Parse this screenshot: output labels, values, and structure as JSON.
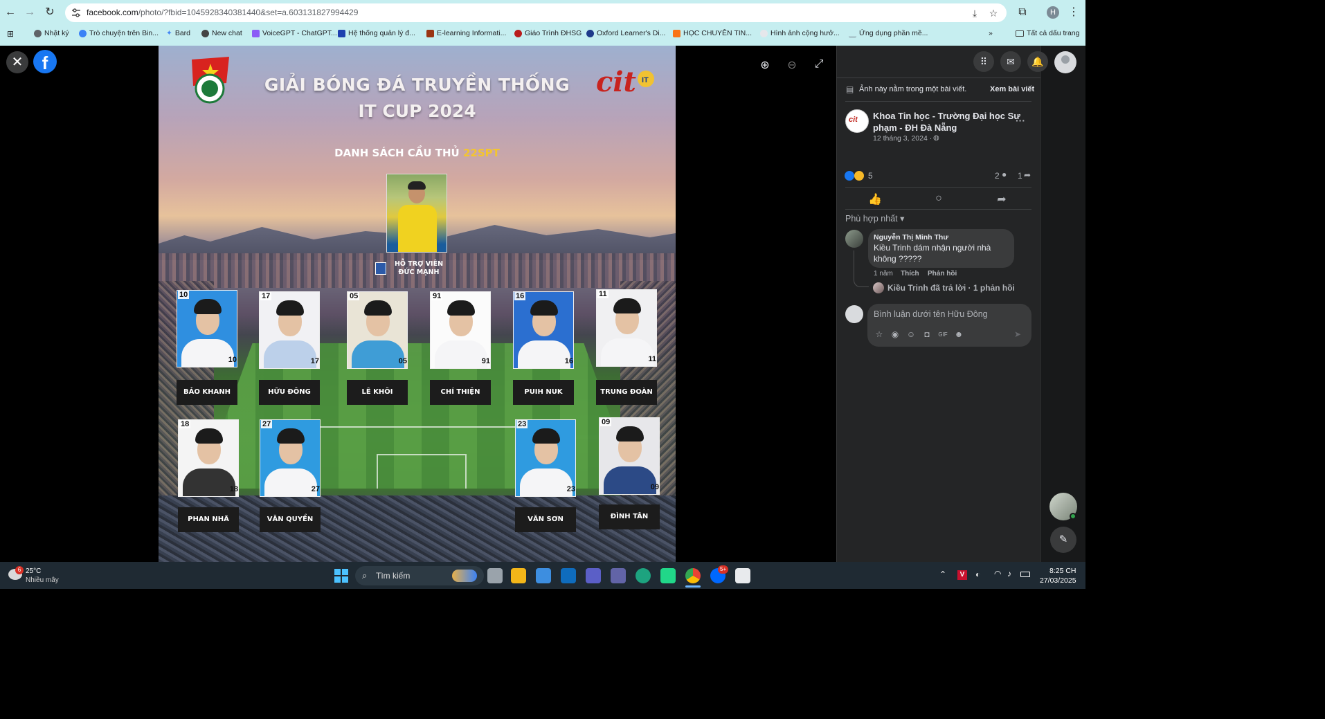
{
  "browser": {
    "url_host": "facebook.com",
    "url_rest": "/photo/?fbid=1045928340381440&set=a.603131827994429",
    "profile_initial": "H",
    "bookmarks": [
      {
        "label": "Nhật ký",
        "color": "#5f6368"
      },
      {
        "label": "Trò chuyện trên Bin...",
        "color": "#3b82f6"
      },
      {
        "label": "Bard",
        "color": "#4285f4"
      },
      {
        "label": "New chat",
        "color": "#444444"
      },
      {
        "label": "VoiceGPT - ChatGPT...",
        "color": "#8b5cf6"
      },
      {
        "label": "Hệ thống quản lý đ...",
        "color": "#1e40af"
      },
      {
        "label": "E-learning Informati...",
        "color": "#9a3412"
      },
      {
        "label": "Giáo Trình ĐHSG",
        "color": "#b91c1c"
      },
      {
        "label": "Oxford Learner's Di...",
        "color": "#1e3a8a"
      },
      {
        "label": "HỌC CHUYÊN TIN...",
        "color": "#f97316"
      },
      {
        "label": "Hình ảnh cộng hưở...",
        "color": "#9ca3af"
      },
      {
        "label": "Ứng dụng phần mề...",
        "color": "#6b7280"
      }
    ],
    "all_bookmarks": "Tất cả dấu trang"
  },
  "poster": {
    "title_line1": "GIẢI BÓNG ĐÁ TRUYỀN THỐNG",
    "title_line2": "IT CUP 2024",
    "roster_prefix": "DANH SÁCH CẦU THỦ",
    "roster_class": "22SPT",
    "logo_text": "cit",
    "support_role": "HỖ TRỢ VIÊN",
    "support_name": "ĐỨC MẠNH",
    "players_row1": [
      {
        "number": "10",
        "name": "BẢO KHANH"
      },
      {
        "number": "17",
        "name": "HỮU ĐÔNG"
      },
      {
        "number": "05",
        "name": "LÊ KHÔI"
      },
      {
        "number": "91",
        "name": "CHÍ THIỆN"
      },
      {
        "number": "16",
        "name": "PUIH NUK"
      },
      {
        "number": "11",
        "name": "TRUNG ĐOÀN"
      }
    ],
    "players_row2": [
      {
        "number": "18",
        "name": "PHAN NHÃ"
      },
      {
        "number": "27",
        "name": "VĂN QUYỀN"
      },
      {
        "number": "23",
        "name": "VĂN SƠN"
      },
      {
        "number": "09",
        "name": "ĐÌNH TÂN"
      }
    ]
  },
  "panel": {
    "in_post_note": "Ảnh này nằm trong một bài viết.",
    "view_post": "Xem bài viết",
    "page_name_line1": "Khoa Tin học - Trường Đại học Sư",
    "page_name_line2": "phạm - ĐH Đà Nẵng",
    "post_date": "12 tháng 3, 2024 ·",
    "reaction_count": "5",
    "comment_count": "2",
    "share_count": "1",
    "sort_label": "Phù hợp nhất",
    "comment": {
      "author": "Nguyễn Thị Minh Thư",
      "text_line1": "Kiều Trinh dám nhận người nhà",
      "text_line2": "không ?????",
      "time": "1 năm",
      "like": "Thích",
      "reply": "Phản hồi"
    },
    "reply_summary": "Kiều Trinh đã trả lời · 1 phản hồi",
    "comment_placeholder": "Bình luận dưới tên Hữu Đông"
  },
  "taskbar": {
    "weather_temp": "25°C",
    "weather_desc": "Nhiều mây",
    "weather_badge": "6",
    "search_placeholder": "Tìm kiếm",
    "time": "8:25 CH",
    "date": "27/03/2025",
    "chat_badge": "5+"
  }
}
